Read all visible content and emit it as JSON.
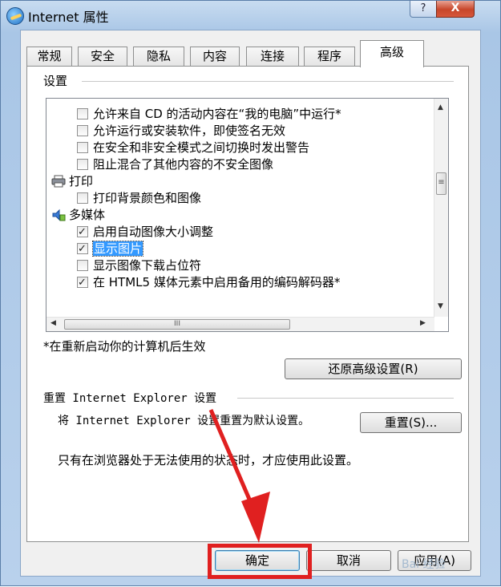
{
  "window": {
    "title": "Internet 属性",
    "help_glyph": "?",
    "close_glyph": "X"
  },
  "tabs": [
    {
      "label": "常规"
    },
    {
      "label": "安全"
    },
    {
      "label": "隐私"
    },
    {
      "label": "内容"
    },
    {
      "label": "连接"
    },
    {
      "label": "程序"
    },
    {
      "label": "高级",
      "active": true
    }
  ],
  "settings": {
    "group_label": "设置",
    "items": [
      {
        "kind": "checkbox",
        "label": "允许来自 CD 的活动内容在“我的电脑”中运行*",
        "checked": false
      },
      {
        "kind": "checkbox",
        "label": "允许运行或安装软件，即使签名无效",
        "checked": false
      },
      {
        "kind": "checkbox",
        "label": "在安全和非安全模式之间切换时发出警告",
        "checked": false
      },
      {
        "kind": "checkbox",
        "label": "阻止混合了其他内容的不安全图像",
        "checked": false
      },
      {
        "kind": "category",
        "label": "打印",
        "icon": "printer-icon"
      },
      {
        "kind": "checkbox",
        "label": "打印背景颜色和图像",
        "checked": false
      },
      {
        "kind": "category",
        "label": "多媒体",
        "icon": "multimedia-icon"
      },
      {
        "kind": "checkbox",
        "label": "启用自动图像大小调整",
        "checked": true
      },
      {
        "kind": "checkbox",
        "label": "显示图片",
        "checked": true,
        "selected": true
      },
      {
        "kind": "checkbox",
        "label": "显示图像下载占位符",
        "checked": false
      },
      {
        "kind": "checkbox",
        "label": "在 HTML5 媒体元素中启用备用的编码解码器*",
        "checked": true
      }
    ],
    "restart_note": "*在重新启动你的计算机后生效",
    "restore_button": "还原高级设置(R)"
  },
  "reset": {
    "group_label": "重置 Internet Explorer 设置",
    "description": "将 Internet Explorer 设置重置为默认设置。",
    "button": "重置(S)...",
    "note": "只有在浏览器处于无法使用的状态时，才应使用此设置。"
  },
  "footer": {
    "ok": "确定",
    "cancel": "取消",
    "apply": "应用(A)"
  },
  "watermark": "Bai 经验",
  "annotation": {
    "arrow_color": "#e02020"
  }
}
